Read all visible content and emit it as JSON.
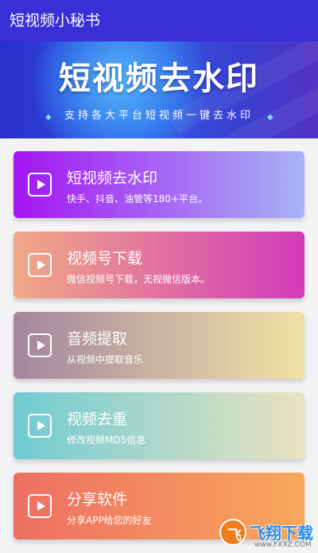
{
  "appbar": {
    "title": "短视频小秘书",
    "color": "#3a2fd6"
  },
  "banner": {
    "title": "短视频去水印",
    "subtitle": "支持各大平台短视频一键去水印",
    "left_arrow": "◆",
    "right_arrow": "◆"
  },
  "cards": [
    {
      "title": "短视频去水印",
      "desc": "快手、抖音、油管等180+平台。",
      "icon": "play-icon",
      "gradient": [
        "#a415f2",
        "#a7b3f6"
      ]
    },
    {
      "title": "视频号下载",
      "desc": "微信视频号下载，无视微信版本。",
      "icon": "play-icon",
      "gradient": [
        "#f0a986",
        "#d23bb9"
      ]
    },
    {
      "title": "音频提取",
      "desc": "从视频中提取音乐",
      "icon": "play-icon",
      "gradient": [
        "#a3859e",
        "#f1e3a5"
      ]
    },
    {
      "title": "视频去重",
      "desc": "修改视频MD5信息",
      "icon": "play-icon",
      "gradient": [
        "#6fcbd2",
        "#ebe3c1"
      ]
    },
    {
      "title": "分享软件",
      "desc": "分享APP给您的好友",
      "icon": "play-icon",
      "gradient": [
        "#ee6e63",
        "#f8a85c"
      ]
    }
  ],
  "watermark": {
    "logo_text": "飞",
    "text": "飞翔下载",
    "url": "www.FXXZ.COM"
  }
}
